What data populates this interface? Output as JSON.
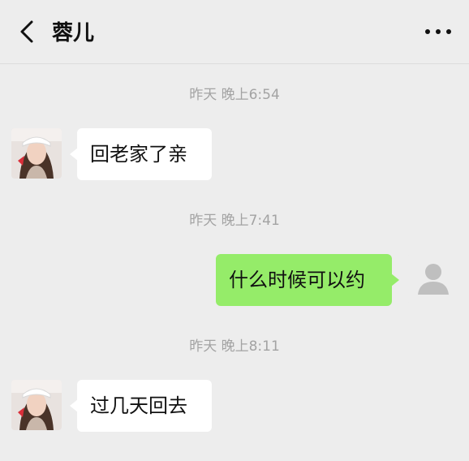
{
  "header": {
    "title": "蓉儿",
    "back_icon": "chevron-left-icon",
    "more_icon": "more-horizontal-icon"
  },
  "messages": [
    {
      "timestamp": "昨天 晚上6:54",
      "sender": "contact",
      "text": "回老家了亲"
    },
    {
      "timestamp": "昨天 晚上7:41",
      "sender": "me",
      "text": "什么时候可以约"
    },
    {
      "timestamp": "昨天 晚上8:11",
      "sender": "contact",
      "text": "过几天回去"
    }
  ],
  "colors": {
    "background": "#ededed",
    "incoming_bubble": "#ffffff",
    "outgoing_bubble": "#95ec69",
    "timestamp_text": "#a3a3a3"
  }
}
